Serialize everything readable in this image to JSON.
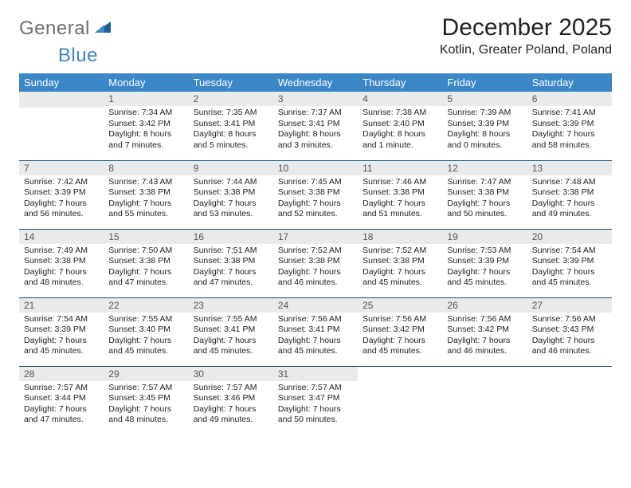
{
  "logo": {
    "part1": "General",
    "part2": "Blue"
  },
  "title": "December 2025",
  "subtitle": "Kotlin, Greater Poland, Poland",
  "weekdays": [
    "Sunday",
    "Monday",
    "Tuesday",
    "Wednesday",
    "Thursday",
    "Friday",
    "Saturday"
  ],
  "start_offset": 1,
  "days": [
    {
      "n": 1,
      "sr": "7:34 AM",
      "ss": "3:42 PM",
      "dl": "8 hours and 7 minutes."
    },
    {
      "n": 2,
      "sr": "7:35 AM",
      "ss": "3:41 PM",
      "dl": "8 hours and 5 minutes."
    },
    {
      "n": 3,
      "sr": "7:37 AM",
      "ss": "3:41 PM",
      "dl": "8 hours and 3 minutes."
    },
    {
      "n": 4,
      "sr": "7:38 AM",
      "ss": "3:40 PM",
      "dl": "8 hours and 1 minute."
    },
    {
      "n": 5,
      "sr": "7:39 AM",
      "ss": "3:39 PM",
      "dl": "8 hours and 0 minutes."
    },
    {
      "n": 6,
      "sr": "7:41 AM",
      "ss": "3:39 PM",
      "dl": "7 hours and 58 minutes."
    },
    {
      "n": 7,
      "sr": "7:42 AM",
      "ss": "3:39 PM",
      "dl": "7 hours and 56 minutes."
    },
    {
      "n": 8,
      "sr": "7:43 AM",
      "ss": "3:38 PM",
      "dl": "7 hours and 55 minutes."
    },
    {
      "n": 9,
      "sr": "7:44 AM",
      "ss": "3:38 PM",
      "dl": "7 hours and 53 minutes."
    },
    {
      "n": 10,
      "sr": "7:45 AM",
      "ss": "3:38 PM",
      "dl": "7 hours and 52 minutes."
    },
    {
      "n": 11,
      "sr": "7:46 AM",
      "ss": "3:38 PM",
      "dl": "7 hours and 51 minutes."
    },
    {
      "n": 12,
      "sr": "7:47 AM",
      "ss": "3:38 PM",
      "dl": "7 hours and 50 minutes."
    },
    {
      "n": 13,
      "sr": "7:48 AM",
      "ss": "3:38 PM",
      "dl": "7 hours and 49 minutes."
    },
    {
      "n": 14,
      "sr": "7:49 AM",
      "ss": "3:38 PM",
      "dl": "7 hours and 48 minutes."
    },
    {
      "n": 15,
      "sr": "7:50 AM",
      "ss": "3:38 PM",
      "dl": "7 hours and 47 minutes."
    },
    {
      "n": 16,
      "sr": "7:51 AM",
      "ss": "3:38 PM",
      "dl": "7 hours and 47 minutes."
    },
    {
      "n": 17,
      "sr": "7:52 AM",
      "ss": "3:38 PM",
      "dl": "7 hours and 46 minutes."
    },
    {
      "n": 18,
      "sr": "7:52 AM",
      "ss": "3:38 PM",
      "dl": "7 hours and 45 minutes."
    },
    {
      "n": 19,
      "sr": "7:53 AM",
      "ss": "3:39 PM",
      "dl": "7 hours and 45 minutes."
    },
    {
      "n": 20,
      "sr": "7:54 AM",
      "ss": "3:39 PM",
      "dl": "7 hours and 45 minutes."
    },
    {
      "n": 21,
      "sr": "7:54 AM",
      "ss": "3:39 PM",
      "dl": "7 hours and 45 minutes."
    },
    {
      "n": 22,
      "sr": "7:55 AM",
      "ss": "3:40 PM",
      "dl": "7 hours and 45 minutes."
    },
    {
      "n": 23,
      "sr": "7:55 AM",
      "ss": "3:41 PM",
      "dl": "7 hours and 45 minutes."
    },
    {
      "n": 24,
      "sr": "7:56 AM",
      "ss": "3:41 PM",
      "dl": "7 hours and 45 minutes."
    },
    {
      "n": 25,
      "sr": "7:56 AM",
      "ss": "3:42 PM",
      "dl": "7 hours and 45 minutes."
    },
    {
      "n": 26,
      "sr": "7:56 AM",
      "ss": "3:42 PM",
      "dl": "7 hours and 46 minutes."
    },
    {
      "n": 27,
      "sr": "7:56 AM",
      "ss": "3:43 PM",
      "dl": "7 hours and 46 minutes."
    },
    {
      "n": 28,
      "sr": "7:57 AM",
      "ss": "3:44 PM",
      "dl": "7 hours and 47 minutes."
    },
    {
      "n": 29,
      "sr": "7:57 AM",
      "ss": "3:45 PM",
      "dl": "7 hours and 48 minutes."
    },
    {
      "n": 30,
      "sr": "7:57 AM",
      "ss": "3:46 PM",
      "dl": "7 hours and 49 minutes."
    },
    {
      "n": 31,
      "sr": "7:57 AM",
      "ss": "3:47 PM",
      "dl": "7 hours and 50 minutes."
    }
  ],
  "labels": {
    "sunrise": "Sunrise:",
    "sunset": "Sunset:",
    "daylight": "Daylight:"
  }
}
